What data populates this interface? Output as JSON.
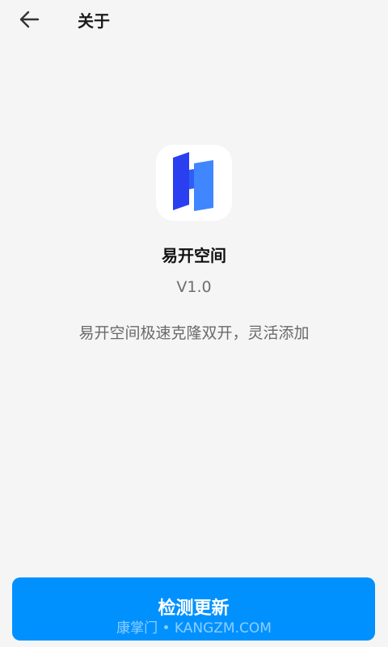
{
  "header": {
    "back_icon": "arrow-left-icon",
    "title": "关于"
  },
  "app": {
    "icon": "app-logo-icon",
    "name": "易开空间",
    "version": "V1.0",
    "description": "易开空间极速克隆双开，灵活添加"
  },
  "actions": {
    "update_label": "检测更新"
  },
  "watermark": {
    "text": "康掌门 • KANGZM.COM"
  },
  "colors": {
    "background": "#f5f5f5",
    "accent": "#0091ff",
    "logo_dark": "#2a3ff0",
    "logo_light": "#3f86ff"
  }
}
